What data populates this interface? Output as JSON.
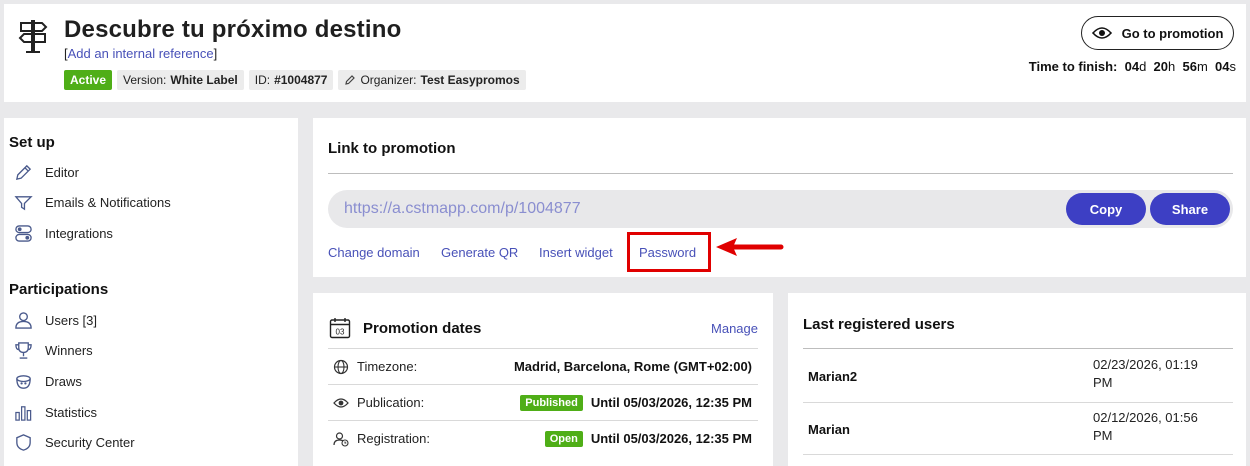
{
  "header": {
    "title": "Descubre tu próximo destino",
    "internal_reference_link": "Add an internal reference",
    "bracket_open": "[",
    "bracket_close": "]",
    "status": "Active",
    "version_label": "Version:",
    "version_value": "White Label",
    "id_label": "ID:",
    "id_value": "#1004877",
    "organizer_label": "Organizer:",
    "organizer_value": "Test Easypromos",
    "go_to_promotion": "Go to promotion",
    "time_label": "Time to finish:",
    "time": {
      "days": "04",
      "days_unit": "d",
      "hours": "20",
      "hours_unit": "h",
      "minutes": "56",
      "minutes_unit": "m",
      "seconds": "04",
      "seconds_unit": "s"
    }
  },
  "sidebar": {
    "setup_title": "Set up",
    "setup_items": [
      {
        "label": "Editor",
        "icon": "pencil-icon"
      },
      {
        "label": "Emails & Notifications",
        "icon": "send-icon"
      },
      {
        "label": "Integrations",
        "icon": "toggles-icon"
      }
    ],
    "participations_title": "Participations",
    "participation_items": [
      {
        "label": "Users [3]",
        "icon": "user-icon"
      },
      {
        "label": "Winners",
        "icon": "trophy-icon"
      },
      {
        "label": "Draws",
        "icon": "draw-bowl-icon"
      },
      {
        "label": "Statistics",
        "icon": "bar-chart-icon"
      },
      {
        "label": "Security Center",
        "icon": "shield-icon"
      }
    ]
  },
  "link_panel": {
    "title": "Link to promotion",
    "url": "https://a.cstmapp.com/p/1004877",
    "copy_label": "Copy",
    "share_label": "Share",
    "actions": [
      "Change domain",
      "Generate QR",
      "Insert widget",
      "Password"
    ],
    "highlight_color": "#e00000"
  },
  "dates_panel": {
    "title": "Promotion dates",
    "calendar_day": "03",
    "manage_label": "Manage",
    "rows": [
      {
        "label": "Timezone:",
        "icon": "globe-icon",
        "badge": "",
        "value": "Madrid, Barcelona, Rome (GMT+02:00)"
      },
      {
        "label": "Publication:",
        "icon": "eye-icon",
        "badge": "Published",
        "value": "Until 05/03/2026, 12:35 PM"
      },
      {
        "label": "Registration:",
        "icon": "user-clock-icon",
        "badge": "Open",
        "value": "Until 05/03/2026, 12:35 PM"
      }
    ]
  },
  "users_panel": {
    "title": "Last registered users",
    "rows": [
      {
        "name": "Marian2",
        "date_line1": "02/23/2026, 01:19",
        "date_line2": "PM"
      },
      {
        "name": "Marian",
        "date_line1": "02/12/2026, 01:56",
        "date_line2": "PM"
      }
    ]
  },
  "colors": {
    "accent": "#3d3fc4",
    "link": "#4851b8",
    "success": "#4fae17",
    "highlight": "#e00000"
  }
}
